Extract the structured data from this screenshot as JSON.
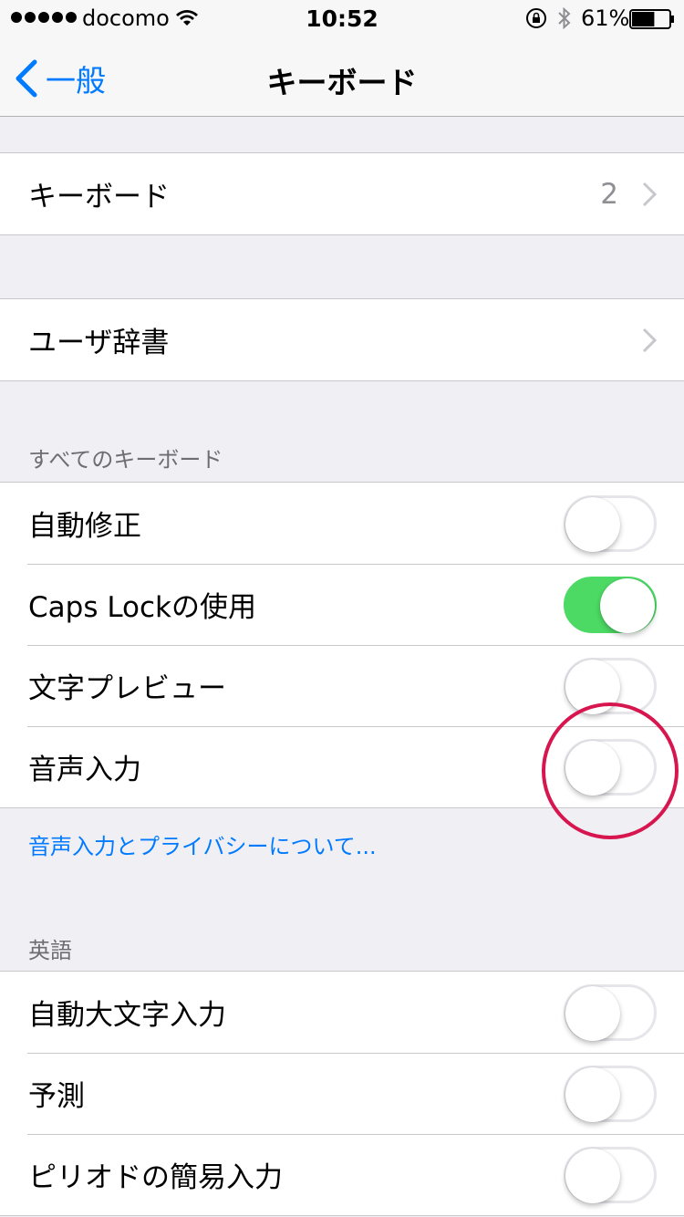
{
  "status_bar": {
    "carrier": "docomo",
    "time": "10:52",
    "battery_percent": "61%",
    "battery_level": 0.61
  },
  "nav": {
    "back_label": "一般",
    "title": "キーボード"
  },
  "keyboards_row": {
    "label": "キーボード",
    "value": "2"
  },
  "user_dict_row": {
    "label": "ユーザ辞書"
  },
  "all_keyboards": {
    "header": "すべてのキーボード",
    "items": [
      {
        "label": "自動修正",
        "on": false
      },
      {
        "label": "Caps Lockの使用",
        "on": true
      },
      {
        "label": "文字プレビュー",
        "on": false
      },
      {
        "label": "音声入力",
        "on": false
      }
    ],
    "footer_link": "音声入力とプライバシーについて..."
  },
  "english": {
    "header": "英語",
    "items": [
      {
        "label": "自動大文字入力",
        "on": false
      },
      {
        "label": "予測",
        "on": false
      },
      {
        "label": "ピリオドの簡易入力",
        "on": false
      }
    ]
  },
  "colors": {
    "accent": "#007aff",
    "switch_on": "#4cd964",
    "highlight": "#d7154f"
  }
}
